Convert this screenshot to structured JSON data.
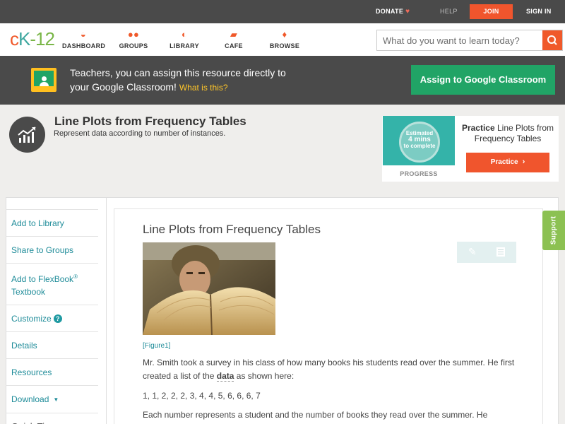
{
  "topbar": {
    "donate": "DONATE",
    "help": "HELP",
    "join": "JOIN",
    "signin": "SIGN IN"
  },
  "nav": {
    "items": [
      {
        "label": "DASHBOARD"
      },
      {
        "label": "GROUPS"
      },
      {
        "label": "LIBRARY"
      },
      {
        "label": "CAFE"
      },
      {
        "label": "BROWSE"
      }
    ],
    "search_placeholder": "What do you want to learn today?"
  },
  "banner": {
    "line1": "Teachers, you can assign this resource directly to",
    "line2": "your Google Classroom!",
    "what_link": "What is this?",
    "assign_button": "Assign to Google Classroom"
  },
  "header": {
    "title": "Line Plots from Frequency Tables",
    "subtitle": "Represent data according to number of instances."
  },
  "practice_card": {
    "badge_line1": "Estimated",
    "badge_line2": "4 mins",
    "badge_line3": "to complete",
    "progress_label": "PROGRESS",
    "prefix": "Practice",
    "title": "Line Plots from Frequency Tables",
    "button": "Practice"
  },
  "sidebar": {
    "items": [
      {
        "label": "Add to Library"
      },
      {
        "label": "Share to Groups"
      },
      {
        "label": "Add to FlexBook"
      },
      {
        "label": "Customize"
      },
      {
        "label": "Details"
      },
      {
        "label": "Resources"
      },
      {
        "label": "Download"
      },
      {
        "label": "Quick Tips"
      }
    ],
    "flexbook_sup": "®",
    "flexbook_line2": "Textbook"
  },
  "article": {
    "title": "Line Plots from Frequency Tables",
    "figure_caption": "[Figure1]",
    "para1_before": "Mr. Smith took a survey in his class of how many books his students read over the summer. He first created a list of the",
    "para1_term": "data",
    "para1_after": "as shown here:",
    "data_list": "1, 1, 2, 2, 2, 3, 4, 4, 5, 6, 6, 6, 7",
    "para2": "Each number represents a student and the number of books they read over the summer. He"
  },
  "support_tab": "Support",
  "colors": {
    "accent_orange": "#f0552d",
    "teal_link": "#1f8c99",
    "google_green": "#21a466",
    "dark_bar": "#4a4a4a",
    "support_green": "#8cc152"
  }
}
